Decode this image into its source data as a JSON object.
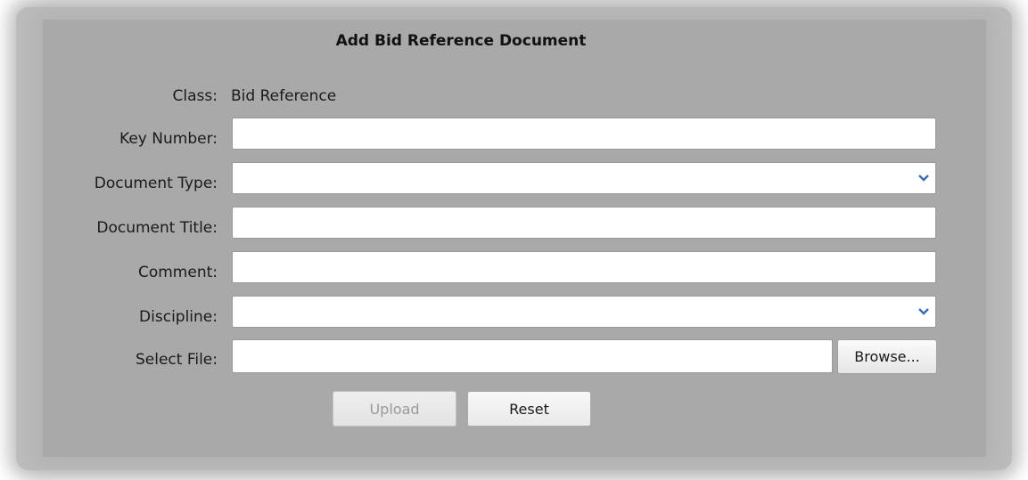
{
  "dialog": {
    "title": "Add Bid Reference Document"
  },
  "form": {
    "class_label": "Class:",
    "class_value": "Bid Reference",
    "key_number_label": "Key Number:",
    "key_number_value": "",
    "document_type_label": "Document Type:",
    "document_type_value": "",
    "document_title_label": "Document Title:",
    "document_title_value": "",
    "comment_label": "Comment:",
    "comment_value": "",
    "discipline_label": "Discipline:",
    "discipline_value": "",
    "select_file_label": "Select File:",
    "select_file_value": "",
    "browse_label": "Browse..."
  },
  "actions": {
    "upload_label": "Upload",
    "upload_enabled": false,
    "reset_label": "Reset"
  },
  "icons": {
    "dropdown": "chevron-down-icon"
  },
  "colors": {
    "panel_background": "#a9a9a9",
    "field_background": "#ffffff",
    "chevron_accent": "#3a6fb0"
  }
}
